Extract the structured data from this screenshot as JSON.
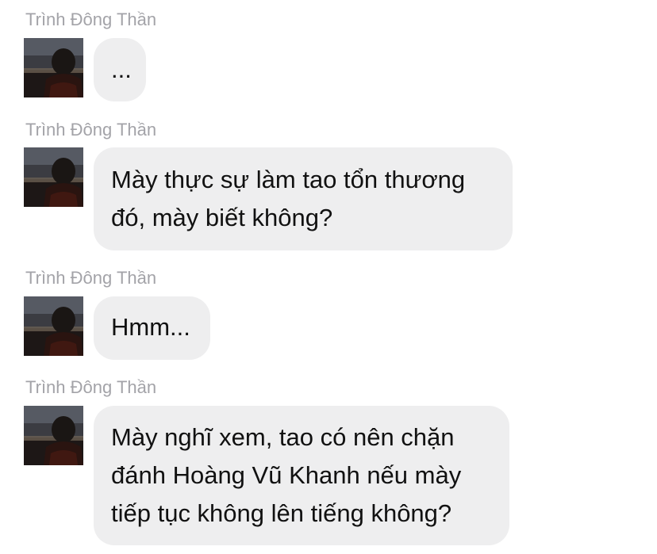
{
  "chat": {
    "messages": [
      {
        "sender": "Trình Đông Thần",
        "lines": [
          "..."
        ]
      },
      {
        "sender": "Trình Đông Thần",
        "lines": [
          "Mày thực sự làm tao tổn thương",
          "đó, mày biết không?"
        ]
      },
      {
        "sender": "Trình Đông Thần",
        "lines": [
          "Hmm..."
        ]
      },
      {
        "sender": "Trình Đông Thần",
        "lines": [
          "Mày nghĩ xem, tao có nên chặn",
          "đánh Hoàng Vũ Khanh nếu mày",
          "tiếp tục không lên tiếng không?"
        ]
      }
    ]
  },
  "colors": {
    "sender_name": "#a3a3a8",
    "bubble_background": "#eeeeef",
    "message_text": "#111111",
    "page_background": "#ffffff"
  },
  "icons": {
    "avatar": "profile-photo-silhouette-at-dusk"
  }
}
